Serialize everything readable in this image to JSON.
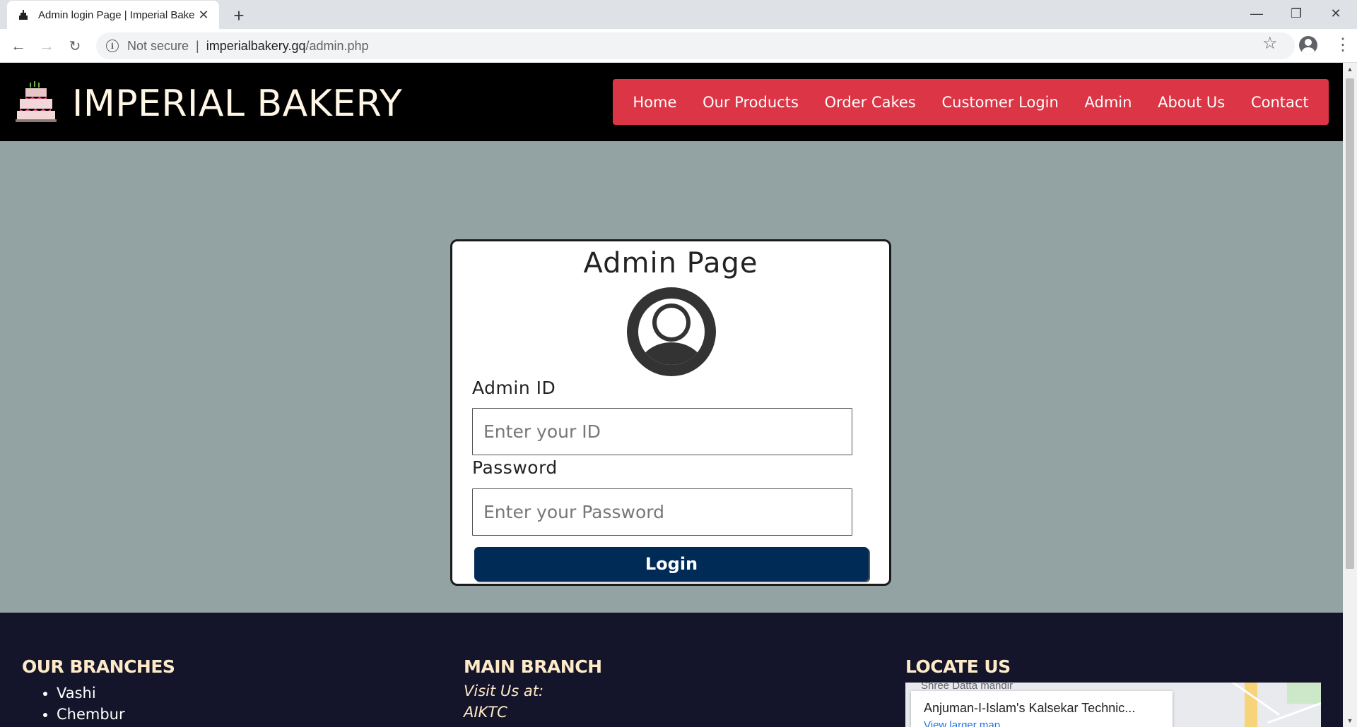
{
  "browser": {
    "tab_title": "Admin login Page | Imperial Bake",
    "new_tab_symbol": "+",
    "close_symbol": "✕",
    "minimize_symbol": "—",
    "restore_symbol": "❐",
    "window_close_symbol": "✕",
    "security_label": "Not secure",
    "url_host": "imperialbakery.gq",
    "url_path": "/admin.php"
  },
  "site": {
    "brand": "IMPERIAL BAKERY",
    "menu": [
      {
        "label": "Home"
      },
      {
        "label": "Our Products"
      },
      {
        "label": "Order Cakes"
      },
      {
        "label": "Customer Login"
      },
      {
        "label": "Admin"
      },
      {
        "label": "About Us"
      },
      {
        "label": "Contact"
      }
    ],
    "colors": {
      "menu_bg": "#dc3545",
      "page_bg": "#93a3a3",
      "button_bg": "#012b57",
      "footer_bg": "#14142a"
    }
  },
  "login": {
    "title": "Admin Page",
    "id_label": "Admin ID",
    "id_placeholder": "Enter your ID",
    "password_label": "Password",
    "password_placeholder": "Enter your Password",
    "button_label": "Login"
  },
  "footer": {
    "branches_heading": "OUR BRANCHES",
    "branches": [
      "Vashi",
      "Chembur"
    ],
    "main_heading": "MAIN BRANCH",
    "visit_text": "Visit Us at:",
    "main_location": "AIKTC",
    "locate_heading": "LOCATE US",
    "map_place": "Anjuman-I-Islam's Kalsekar Technic...",
    "map_link": "View larger map",
    "map_background_label": "Shree Datta mandir"
  }
}
